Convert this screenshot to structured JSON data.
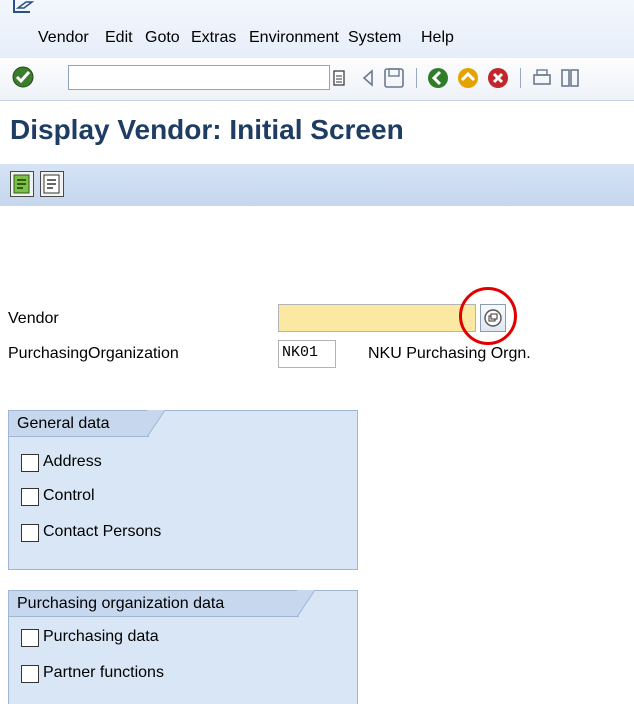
{
  "menu": {
    "items": [
      "Vendor",
      "Edit",
      "Goto",
      "Extras",
      "Environment",
      "System",
      "Help"
    ]
  },
  "toolbar": {
    "command_value": ""
  },
  "title": "Display Vendor: Initial Screen",
  "fields": {
    "vendor_label": "Vendor",
    "vendor_value": "",
    "porg_label": "PurchasingOrganization",
    "porg_value": "NK01",
    "porg_desc": "NKU Purchasing Orgn."
  },
  "general_data": {
    "title": "General data",
    "items": [
      "Address",
      "Control",
      "Contact Persons"
    ]
  },
  "purch_data": {
    "title": "Purchasing organization data",
    "items": [
      "Purchasing data",
      "Partner functions"
    ]
  },
  "colors": {
    "title": "#1f3d63",
    "required_field": "#fbe9a3",
    "highlight_circle": "#e10000",
    "group_bg": "#d9e6f5"
  }
}
